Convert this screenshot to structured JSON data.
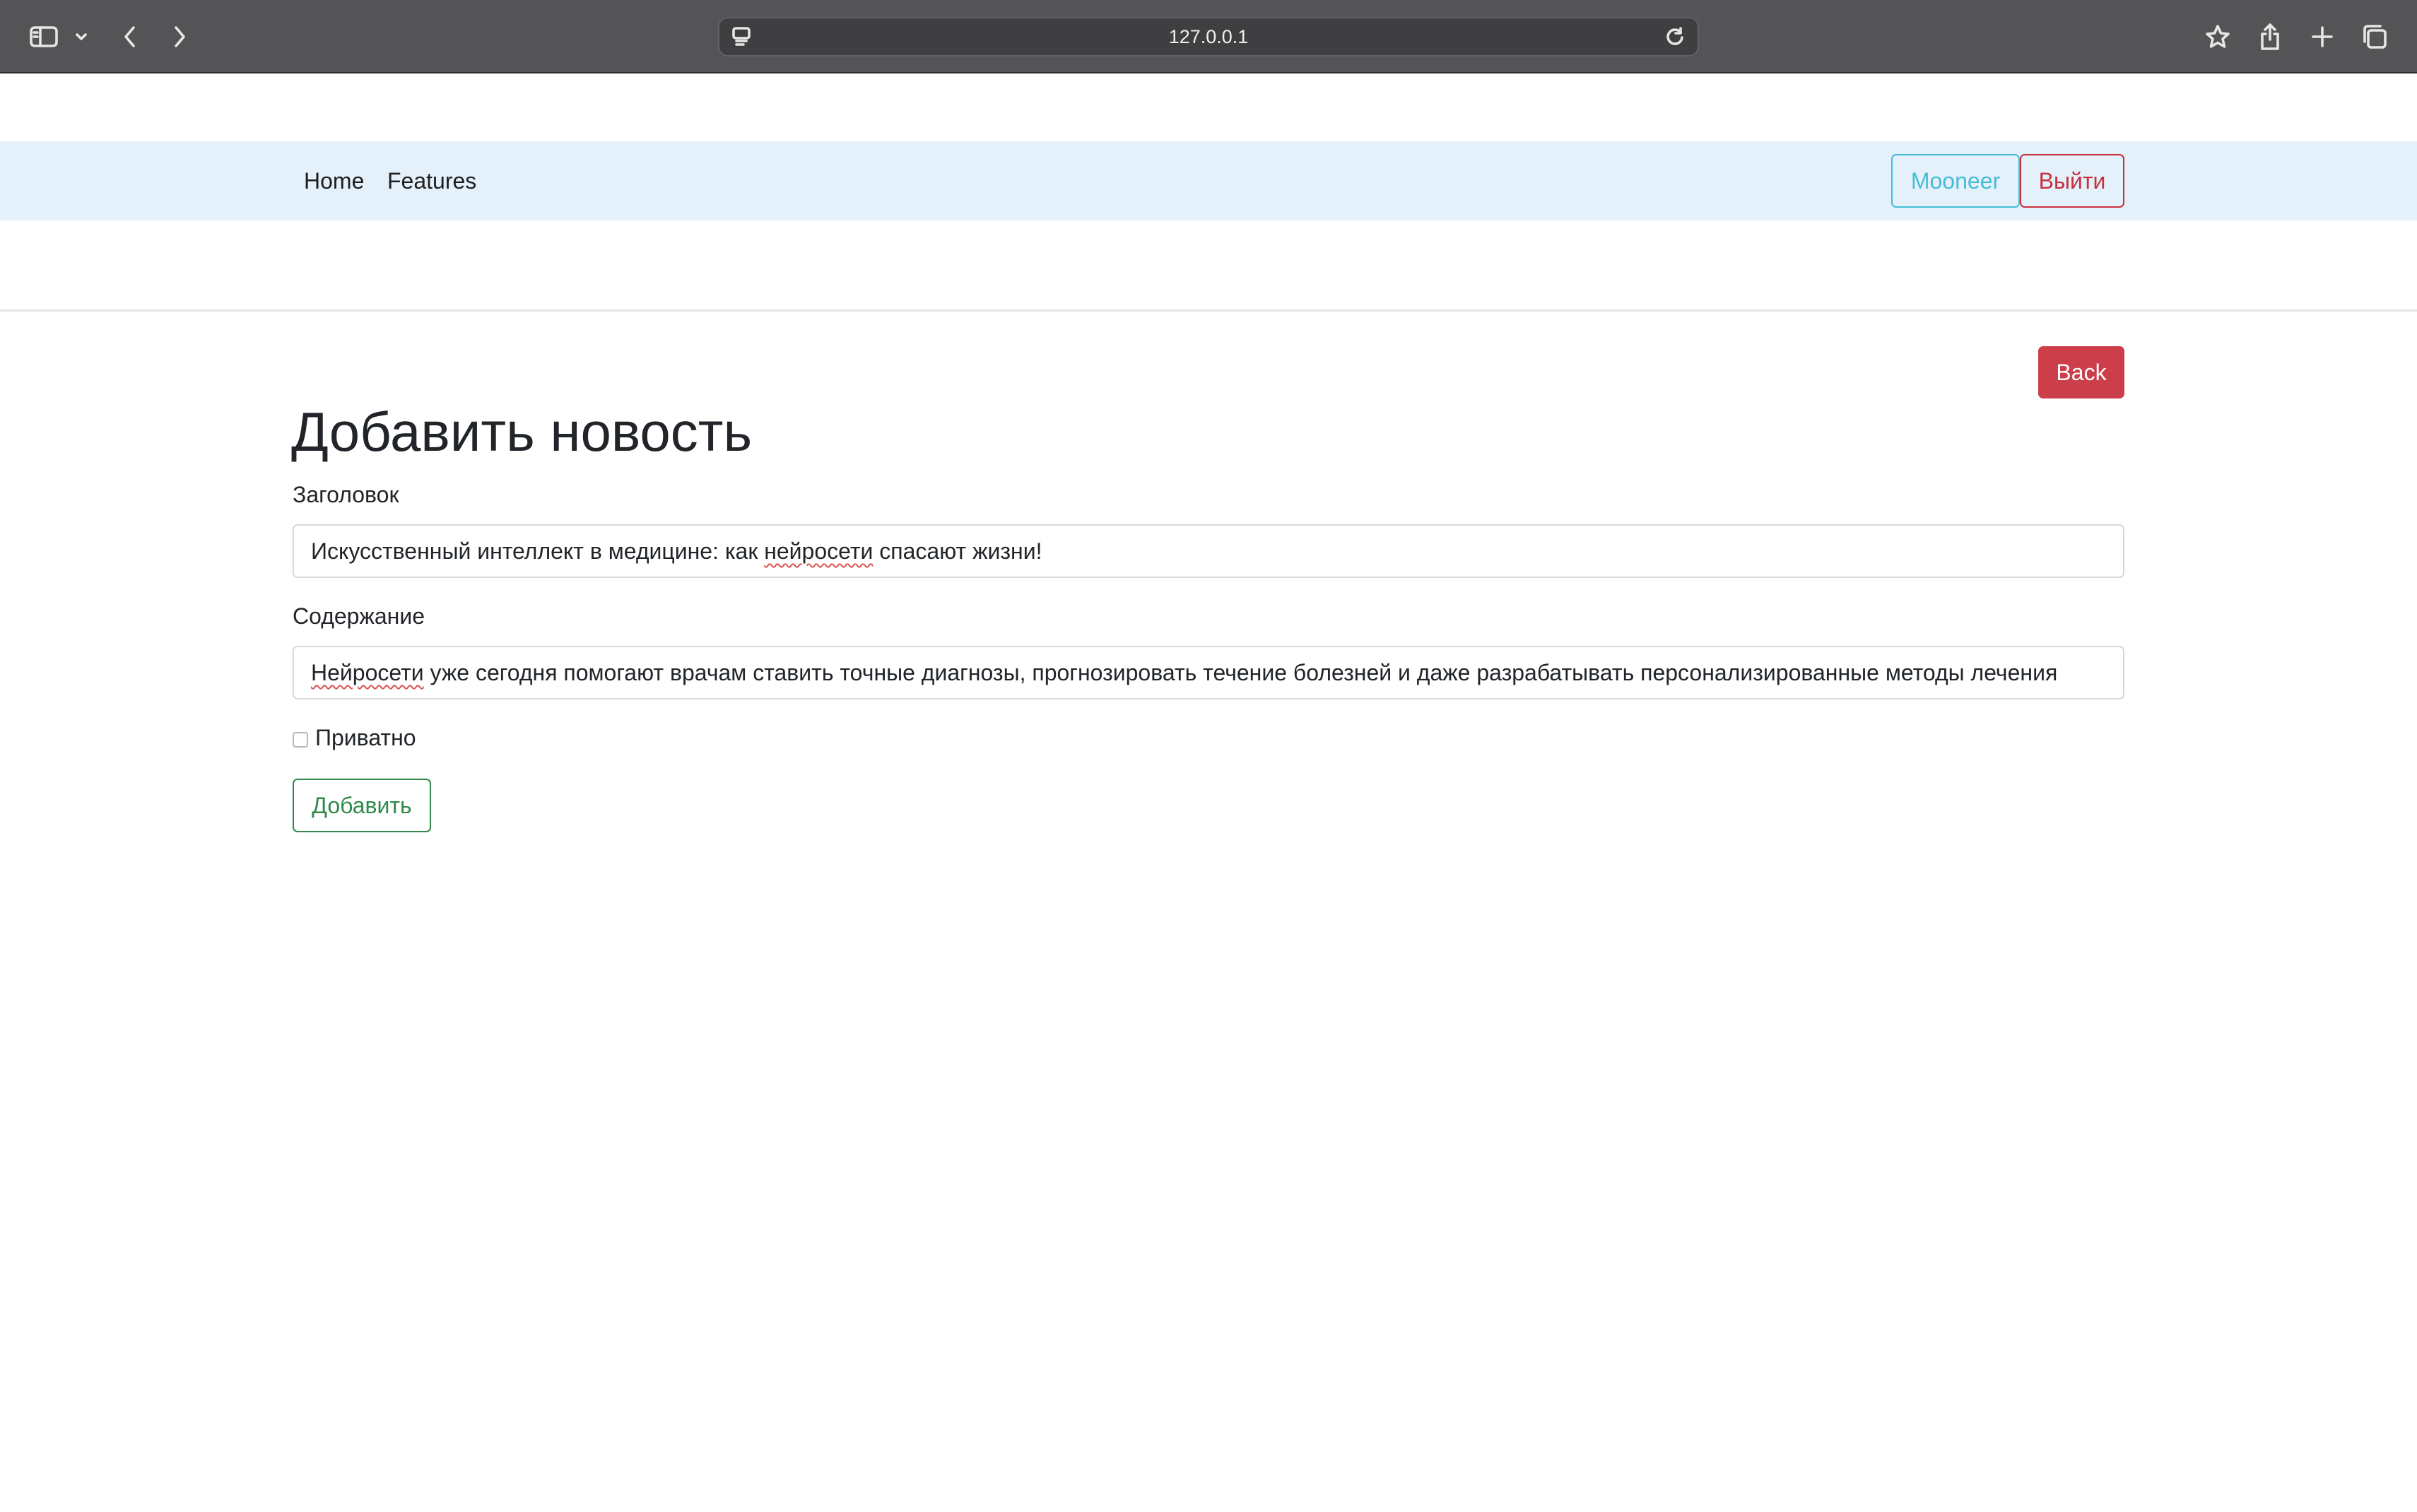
{
  "browser": {
    "url": "127.0.0.1",
    "icons": [
      "sidebar-icon",
      "chevron-down-icon",
      "back-arrow-icon",
      "forward-arrow-icon",
      "page-menu-icon",
      "reload-icon",
      "star-icon",
      "share-icon",
      "plus-icon",
      "tabs-icon"
    ]
  },
  "navbar": {
    "links": [
      "Home",
      "Features"
    ],
    "user_button": "Mooneer",
    "logout_button": "Выйти"
  },
  "main": {
    "back_button": "Back",
    "title": "Добавить новость",
    "title_label": "Заголовок",
    "title_value_before": "Искусственный интеллект в медицине: как ",
    "title_value_misspelled": "нейросети",
    "title_value_after": " спасают жизни!",
    "content_label": "Содержание",
    "content_value_misspelled": "Нейросети",
    "content_value_after": " уже сегодня помогают врачам ставить точные диагнозы, прогнозировать течение болезней и даже разрабатывать персонализированные методы лечения",
    "private_label": "Приватно",
    "private_checked": false,
    "submit_button": "Добавить"
  },
  "colors": {
    "navbar_bg": "#e5f1fa",
    "info": "#45bdd6",
    "danger": "#cc3f4a",
    "success": "#2f8a4a"
  }
}
